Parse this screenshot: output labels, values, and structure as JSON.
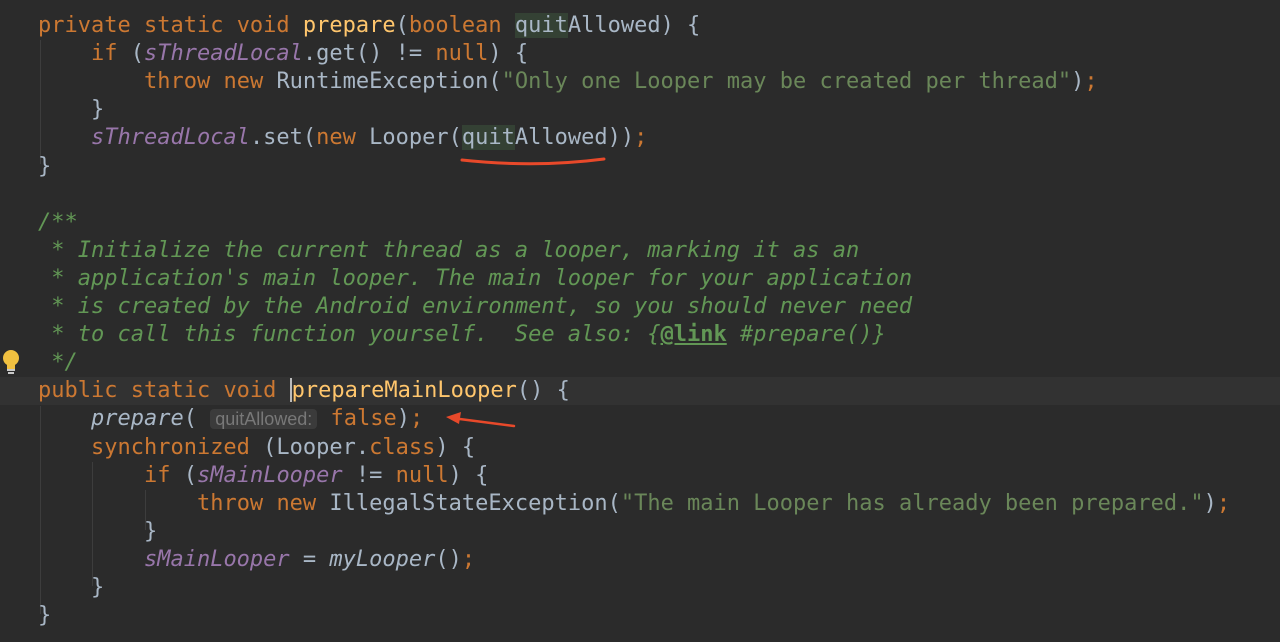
{
  "editor": {
    "lines": [
      {
        "name": "line-prepare-signature",
        "tokens": [
          {
            "t": "private ",
            "c": "kw"
          },
          {
            "t": "static ",
            "c": "kw"
          },
          {
            "t": "void ",
            "c": "kw"
          },
          {
            "t": "prepare",
            "c": "fn"
          },
          {
            "t": "(",
            "c": ""
          },
          {
            "t": "boolean ",
            "c": "kw"
          },
          {
            "t": "quit",
            "c": "hl"
          },
          {
            "t": "Allowed",
            "c": ""
          },
          {
            "t": ") {",
            "c": ""
          }
        ]
      },
      {
        "name": "line-if-sthreadlocal",
        "tokens": [
          {
            "t": "    ",
            "c": ""
          },
          {
            "t": "if ",
            "c": "kw"
          },
          {
            "t": "(",
            "c": ""
          },
          {
            "t": "sThreadLocal",
            "c": "sf"
          },
          {
            "t": ".get() != ",
            "c": ""
          },
          {
            "t": "null",
            "c": "kw"
          },
          {
            "t": ") {",
            "c": ""
          }
        ]
      },
      {
        "name": "line-throw-runtime",
        "tokens": [
          {
            "t": "        ",
            "c": ""
          },
          {
            "t": "throw ",
            "c": "kw"
          },
          {
            "t": "new ",
            "c": "kw"
          },
          {
            "t": "RuntimeException(",
            "c": ""
          },
          {
            "t": "\"Only one Looper may be created per thread\"",
            "c": "str"
          },
          {
            "t": ")",
            "c": ""
          },
          {
            "t": ";",
            "c": "kw"
          }
        ]
      },
      {
        "name": "line-close-if-1",
        "tokens": [
          {
            "t": "    }",
            "c": ""
          }
        ]
      },
      {
        "name": "line-sthreadlocal-set",
        "tokens": [
          {
            "t": "    ",
            "c": ""
          },
          {
            "t": "sThreadLocal",
            "c": "sf"
          },
          {
            "t": ".set(",
            "c": ""
          },
          {
            "t": "new ",
            "c": "kw"
          },
          {
            "t": "Looper(",
            "c": ""
          },
          {
            "t": "quit",
            "c": "hl"
          },
          {
            "t": "Allowed))",
            "c": ""
          },
          {
            "t": ";",
            "c": "kw"
          }
        ]
      },
      {
        "name": "line-close-prepare",
        "tokens": [
          {
            "t": "}",
            "c": ""
          }
        ]
      },
      {
        "name": "line-blank",
        "tokens": []
      },
      {
        "name": "line-doc-open",
        "tokens": [
          {
            "t": "/**",
            "c": "doc"
          }
        ]
      },
      {
        "name": "line-doc-1",
        "tokens": [
          {
            "t": " * Initialize the current thread as a looper, marking it as an",
            "c": "doc"
          }
        ]
      },
      {
        "name": "line-doc-2",
        "tokens": [
          {
            "t": " * application's main looper. The main looper for your application",
            "c": "doc"
          }
        ]
      },
      {
        "name": "line-doc-3",
        "tokens": [
          {
            "t": " * is created by the Android environment, so you should never need",
            "c": "doc"
          }
        ]
      },
      {
        "name": "line-doc-4",
        "tokens": [
          {
            "t": " * to call this function yourself.  See also: ",
            "c": "doc"
          },
          {
            "t": "{",
            "c": "doc"
          },
          {
            "t": "@link",
            "c": "doctag"
          },
          {
            "t": " #prepare()}",
            "c": "doc"
          }
        ]
      },
      {
        "name": "line-doc-close",
        "tokens": [
          {
            "t": " */",
            "c": "doc"
          }
        ]
      },
      {
        "name": "line-preparemainlooper-signature",
        "current": true,
        "tokens": [
          {
            "t": "public ",
            "c": "kw"
          },
          {
            "t": "static ",
            "c": "kw"
          },
          {
            "t": "void ",
            "c": "kw"
          },
          {
            "t": "",
            "c": "caret"
          },
          {
            "t": "prepareMainLooper",
            "c": "fn"
          },
          {
            "t": "() {",
            "c": ""
          }
        ]
      },
      {
        "name": "line-prepare-call",
        "tokens": [
          {
            "t": "    ",
            "c": ""
          },
          {
            "t": "prepare",
            "c": "it"
          },
          {
            "t": "( ",
            "c": ""
          },
          {
            "t": "quitAllowed:",
            "c": "hint"
          },
          {
            "t": " ",
            "c": ""
          },
          {
            "t": "false",
            "c": "kw"
          },
          {
            "t": ")",
            "c": ""
          },
          {
            "t": ";",
            "c": "kw"
          }
        ]
      },
      {
        "name": "line-synchronized",
        "tokens": [
          {
            "t": "    ",
            "c": ""
          },
          {
            "t": "synchronized ",
            "c": "kw"
          },
          {
            "t": "(Looper.",
            "c": ""
          },
          {
            "t": "class",
            "c": "kw"
          },
          {
            "t": ") {",
            "c": ""
          }
        ]
      },
      {
        "name": "line-if-smainlooper",
        "tokens": [
          {
            "t": "        ",
            "c": ""
          },
          {
            "t": "if ",
            "c": "kw"
          },
          {
            "t": "(",
            "c": ""
          },
          {
            "t": "sMainLooper",
            "c": "sf"
          },
          {
            "t": " != ",
            "c": ""
          },
          {
            "t": "null",
            "c": "kw"
          },
          {
            "t": ") {",
            "c": ""
          }
        ]
      },
      {
        "name": "line-throw-illegalstate",
        "tokens": [
          {
            "t": "            ",
            "c": ""
          },
          {
            "t": "throw ",
            "c": "kw"
          },
          {
            "t": "new ",
            "c": "kw"
          },
          {
            "t": "IllegalStateException(",
            "c": ""
          },
          {
            "t": "\"The main Looper has already been prepared.\"",
            "c": "str"
          },
          {
            "t": ")",
            "c": ""
          },
          {
            "t": ";",
            "c": "kw"
          }
        ]
      },
      {
        "name": "line-close-if-2",
        "tokens": [
          {
            "t": "        }",
            "c": ""
          }
        ]
      },
      {
        "name": "line-assign-smainlooper",
        "tokens": [
          {
            "t": "        ",
            "c": ""
          },
          {
            "t": "sMainLooper",
            "c": "sf"
          },
          {
            "t": " = ",
            "c": ""
          },
          {
            "t": "myLooper",
            "c": "it"
          },
          {
            "t": "()",
            "c": ""
          },
          {
            "t": ";",
            "c": "kw"
          }
        ]
      },
      {
        "name": "line-close-synchronized",
        "tokens": [
          {
            "t": "    }",
            "c": ""
          }
        ]
      },
      {
        "name": "line-close-preparemainlooper",
        "tokens": [
          {
            "t": "}",
            "c": ""
          }
        ]
      }
    ]
  },
  "gutter": {
    "bulb_icon": "lightbulb-intention-icon"
  },
  "annotations": {
    "underline_color": "#e8492a",
    "arrow_color": "#e8492a"
  },
  "colors": {
    "background": "#2b2b2b",
    "keyword": "#cc7832",
    "method": "#ffc66d",
    "string": "#6a8759",
    "static_field": "#9876aa",
    "doc_comment": "#629755",
    "default_text": "#a9b7c6"
  }
}
